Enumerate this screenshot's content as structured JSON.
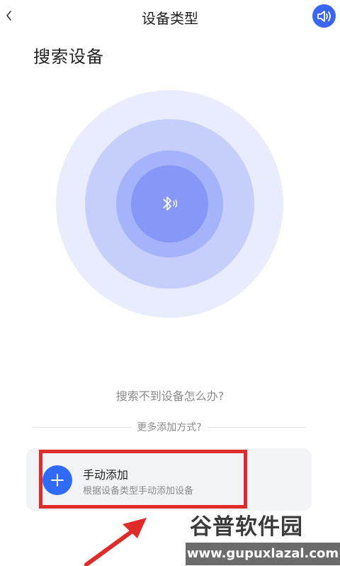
{
  "header": {
    "title": "设备类型"
  },
  "page": {
    "title": "搜索设备"
  },
  "help": {
    "link_text": "搜索不到设备怎么办?"
  },
  "more_methods": {
    "label": "更多添加方式?"
  },
  "manual_add": {
    "title": "手动添加",
    "subtitle": "根据设备类型手动添加设备"
  },
  "watermark": {
    "logo_text": "谷普软件园",
    "url": "www.gupuxlazal.com"
  },
  "icons": {
    "back": "chevron-left-icon",
    "sound": "speaker-icon",
    "scan": "bluetooth-icon",
    "add": "plus-icon"
  },
  "colors": {
    "accent": "#3b66f5",
    "add_button": "#2f6bf6",
    "radar_ring_outer": "#e8ecfd",
    "radar_ring_2": "#c6cffb",
    "radar_ring_3": "#a5b3fa",
    "radar_ring_inner": "#8697f8",
    "highlight": "#e02b2b"
  }
}
